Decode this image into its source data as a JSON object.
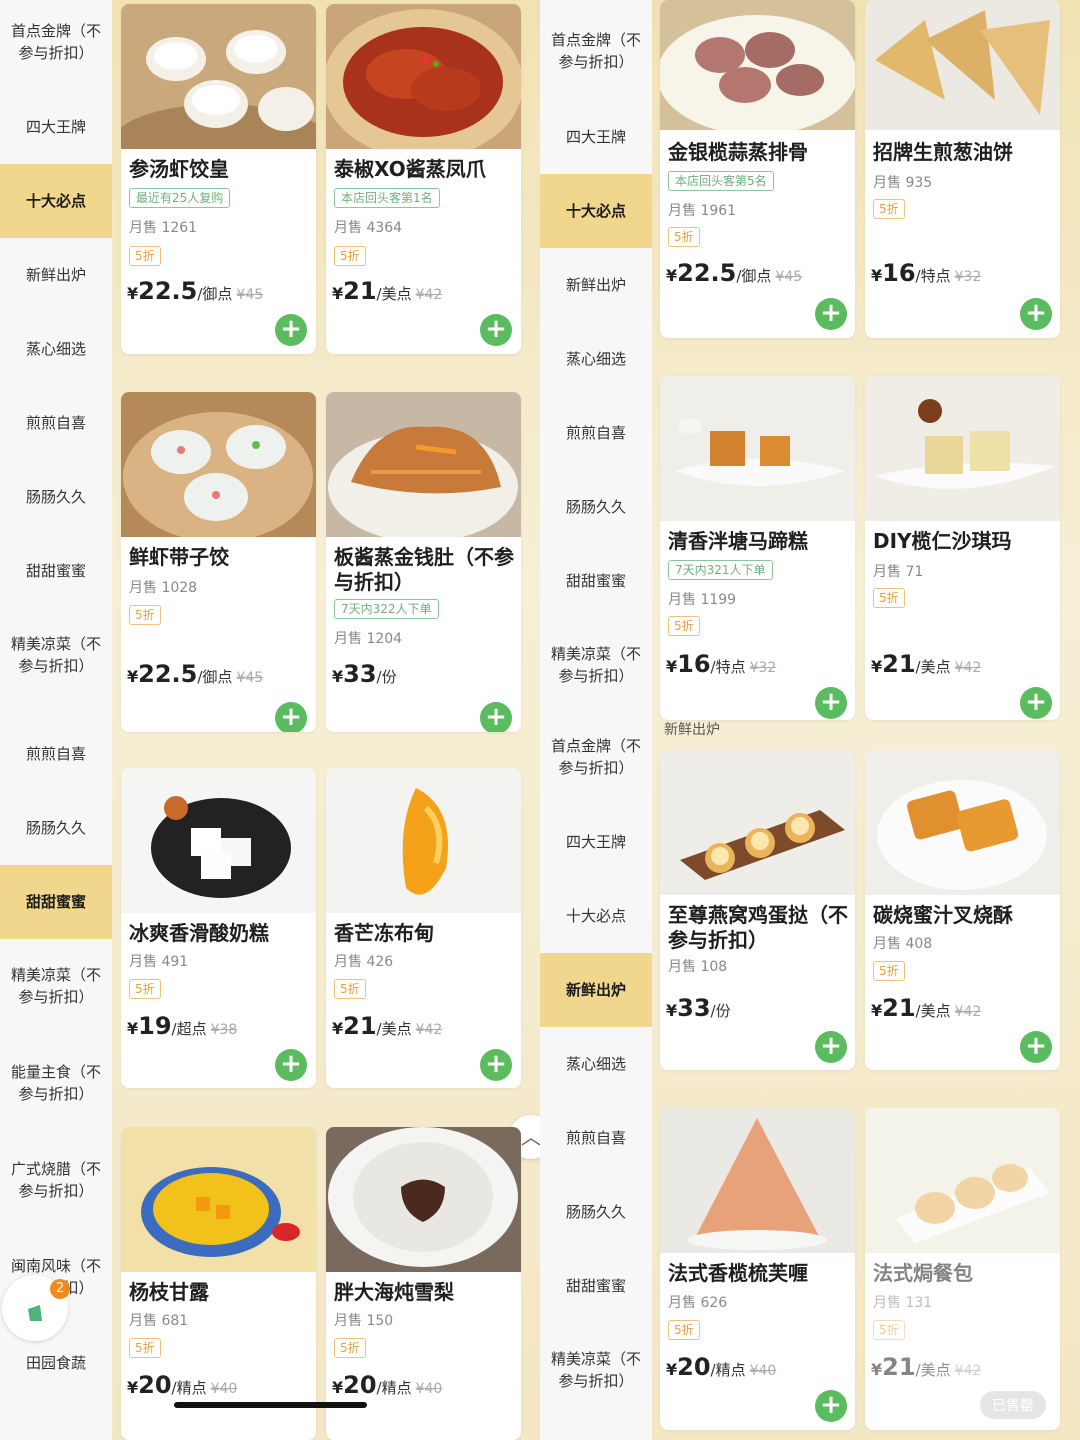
{
  "colors": {
    "accent_green": "#5bbb5f",
    "active_category": "#f1d68e",
    "discount_orange": "#e8a23a",
    "tag_green": "#6fb07e"
  },
  "left": {
    "sidebar": [
      {
        "label": "首点金牌（不参与折扣）",
        "active": false
      },
      {
        "label": "四大王牌",
        "active": false
      },
      {
        "label": "十大必点",
        "active": true
      },
      {
        "label": "新鲜出炉",
        "active": false
      },
      {
        "label": "蒸心细选",
        "active": false
      },
      {
        "label": "煎煎自喜",
        "active": false
      },
      {
        "label": "肠肠久久",
        "active": false
      },
      {
        "label": "甜甜蜜蜜",
        "active": false
      },
      {
        "label": "精美凉菜（不参与折扣）",
        "active": false
      }
    ],
    "sidebar2": [
      {
        "label": "煎煎自喜",
        "active": false
      },
      {
        "label": "肠肠久久",
        "active": false
      },
      {
        "label": "甜甜蜜蜜",
        "active": true
      },
      {
        "label": "精美凉菜（不参与折扣）",
        "active": false
      },
      {
        "label": "能量主食（不参与折扣）",
        "active": false
      },
      {
        "label": "广式烧腊（不参与折扣）",
        "active": false
      },
      {
        "label": "闽南风味（不参与折扣）",
        "active": false
      },
      {
        "label": "田园食蔬",
        "active": false
      }
    ],
    "cart_count": "2",
    "products": [
      {
        "name": "参汤虾饺皇",
        "tag": "最近有25人复购",
        "sales": "月售 1261",
        "discount": "5折",
        "cur": "¥",
        "price": "22.5",
        "unit": "/御点",
        "orig": "¥45",
        "add": "+"
      },
      {
        "name": "泰椒XO酱蒸凤爪",
        "tag": "本店回头客第1名",
        "sales": "月售 4364",
        "discount": "5折",
        "cur": "¥",
        "price": "21",
        "unit": "/美点",
        "orig": "¥42",
        "add": "+"
      },
      {
        "name": "鲜虾带子饺",
        "tag": "",
        "sales": "月售 1028",
        "discount": "5折",
        "cur": "¥",
        "price": "22.5",
        "unit": "/御点",
        "orig": "¥45",
        "add": "+"
      },
      {
        "name": "板酱蒸金钱肚（不参与折扣）",
        "tag": "7天内322人下单",
        "sales": "月售 1204",
        "discount": "",
        "cur": "¥",
        "price": "33",
        "unit": "/份",
        "orig": "",
        "add": "+"
      },
      {
        "name": "冰爽香滑酸奶糕",
        "tag": "",
        "sales": "月售 491",
        "discount": "5折",
        "cur": "¥",
        "price": "19",
        "unit": "/超点",
        "orig": "¥38",
        "add": "+"
      },
      {
        "name": "香芒冻布甸",
        "tag": "",
        "sales": "月售 426",
        "discount": "5折",
        "cur": "¥",
        "price": "21",
        "unit": "/美点",
        "orig": "¥42",
        "add": "+"
      },
      {
        "name": "杨枝甘露",
        "tag": "",
        "sales": "月售 681",
        "discount": "5折",
        "cur": "¥",
        "price": "20",
        "unit": "/精点",
        "orig": "¥40",
        "add": "+"
      },
      {
        "name": "胖大海炖雪梨",
        "tag": "",
        "sales": "月售 150",
        "discount": "5折",
        "cur": "¥",
        "price": "20",
        "unit": "/精点",
        "orig": "¥40",
        "add": "+"
      }
    ]
  },
  "right": {
    "sidebar": [
      {
        "label": "首点金牌（不参与折扣）",
        "active": false
      },
      {
        "label": "四大王牌",
        "active": false
      },
      {
        "label": "十大必点",
        "active": true
      },
      {
        "label": "新鲜出炉",
        "active": false
      },
      {
        "label": "蒸心细选",
        "active": false
      },
      {
        "label": "煎煎自喜",
        "active": false
      },
      {
        "label": "肠肠久久",
        "active": false
      },
      {
        "label": "甜甜蜜蜜",
        "active": false
      },
      {
        "label": "精美凉菜（不参与折扣）",
        "active": false
      }
    ],
    "sidebar2": [
      {
        "label": "首点金牌（不参与折扣）",
        "active": false
      },
      {
        "label": "四大王牌",
        "active": false
      },
      {
        "label": "十大必点",
        "active": false
      },
      {
        "label": "新鲜出炉",
        "active": true
      },
      {
        "label": "蒸心细选",
        "active": false
      },
      {
        "label": "煎煎自喜",
        "active": false
      },
      {
        "label": "肠肠久久",
        "active": false
      },
      {
        "label": "甜甜蜜蜜",
        "active": false
      },
      {
        "label": "精美凉菜（不参与折扣）",
        "active": false
      }
    ],
    "section_label": "新鲜出炉",
    "sold_out": "已售罄",
    "products": [
      {
        "name": "金银榄蒜蒸排骨",
        "tag": "本店回头客第5名",
        "sales": "月售 1961",
        "discount": "5折",
        "cur": "¥",
        "price": "22.5",
        "unit": "/御点",
        "orig": "¥45",
        "add": "+"
      },
      {
        "name": "招牌生煎葱油饼",
        "tag": "",
        "sales": "月售 935",
        "discount": "5折",
        "cur": "¥",
        "price": "16",
        "unit": "/特点",
        "orig": "¥32",
        "add": "+"
      },
      {
        "name": "清香泮塘马蹄糕",
        "tag": "7天内321人下单",
        "sales": "月售 1199",
        "discount": "5折",
        "cur": "¥",
        "price": "16",
        "unit": "/特点",
        "orig": "¥32",
        "add": "+"
      },
      {
        "name": "DIY榄仁沙琪玛",
        "tag": "",
        "sales": "月售 71",
        "discount": "5折",
        "cur": "¥",
        "price": "21",
        "unit": "/美点",
        "orig": "¥42",
        "add": "+"
      },
      {
        "name": "至尊燕窝鸡蛋挞（不参与折扣）",
        "tag": "",
        "sales": "月售 108",
        "discount": "",
        "cur": "¥",
        "price": "33",
        "unit": "/份",
        "orig": "",
        "add": "+"
      },
      {
        "name": "碳烧蜜汁叉烧酥",
        "tag": "",
        "sales": "月售 408",
        "discount": "5折",
        "cur": "¥",
        "price": "21",
        "unit": "/美点",
        "orig": "¥42",
        "add": "+"
      },
      {
        "name": "法式香榄梳芙喱",
        "tag": "",
        "sales": "月售 626",
        "discount": "5折",
        "cur": "¥",
        "price": "20",
        "unit": "/精点",
        "orig": "¥40",
        "add": "+"
      },
      {
        "name": "法式焗餐包",
        "tag": "",
        "sales": "月售 131",
        "discount": "5折",
        "cur": "¥",
        "price": "21",
        "unit": "/美点",
        "orig": "¥42",
        "add": ""
      }
    ]
  }
}
